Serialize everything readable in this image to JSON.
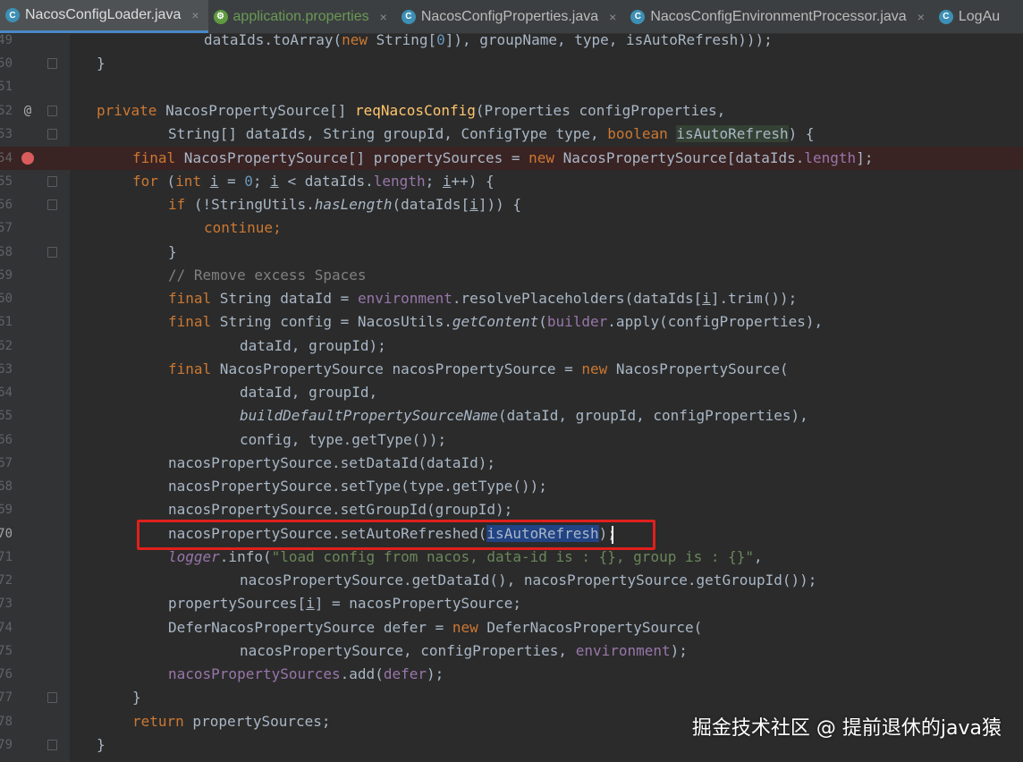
{
  "tabs": [
    {
      "label": "NacosConfigLoader.java",
      "icon": "java-class-icon",
      "active": true
    },
    {
      "label": "application.properties",
      "icon": "properties-file-icon",
      "active": false
    },
    {
      "label": "NacosConfigProperties.java",
      "icon": "java-class-icon",
      "active": false
    },
    {
      "label": "NacosConfigEnvironmentProcessor.java",
      "icon": "java-class-icon",
      "active": false
    },
    {
      "label": "LogAu",
      "icon": "java-class-icon",
      "active": false
    }
  ],
  "tab_close_glyph": "×",
  "gutter": {
    "line_numbers": [
      "49",
      "50",
      "51",
      "52",
      "53",
      "54",
      "55",
      "56",
      "57",
      "58",
      "59",
      "60",
      "61",
      "62",
      "63",
      "64",
      "65",
      "66",
      "67",
      "68",
      "69",
      "70",
      "71",
      "72",
      "73",
      "74",
      "75",
      "76",
      "77",
      "78",
      "79"
    ],
    "override_glyph": "@"
  },
  "code": {
    "l49_a": "dataIds.toArray(",
    "l49_b": "new",
    "l49_c": " String[",
    "l49_d": "0",
    "l49_e": "]), groupName, type, isAutoRefresh)));",
    "l50": "}",
    "l52_a": "private",
    "l52_b": " NacosPropertySource[] ",
    "l52_c": "reqNacosConfig",
    "l52_d": "(Properties configProperties,",
    "l53_a": "String[] dataIds, String groupId, ConfigType type, ",
    "l53_b": "boolean",
    "l53_c": " ",
    "l53_d": "isAutoRefresh",
    "l53_e": ") {",
    "l54_a": "final",
    "l54_b": " NacosPropertySource[] propertySources = ",
    "l54_c": "new",
    "l54_d": " NacosPropertySource[dataIds.",
    "l54_e": "length",
    "l54_f": "];",
    "l55_a": "for",
    "l55_b": " (",
    "l55_c": "int",
    "l55_d": " ",
    "l55_e": "i",
    "l55_f": " = ",
    "l55_g": "0",
    "l55_h": "; ",
    "l55_i": "i",
    "l55_j": " < dataIds.",
    "l55_k": "length",
    "l55_l": "; ",
    "l55_m": "i",
    "l55_n": "++) {",
    "l56_a": "if",
    "l56_b": " (!StringUtils.",
    "l56_c": "hasLength",
    "l56_d": "(dataIds[",
    "l56_e": "i",
    "l56_f": "])) {",
    "l57": "continue;",
    "l58": "}",
    "l59": "// Remove excess Spaces",
    "l60_a": "final",
    "l60_b": " String dataId = ",
    "l60_c": "environment",
    "l60_d": ".resolvePlaceholders(dataIds[",
    "l60_e": "i",
    "l60_f": "].trim());",
    "l61_a": "final",
    "l61_b": " String config = NacosUtils.",
    "l61_c": "getContent",
    "l61_d": "(",
    "l61_e": "builder",
    "l61_f": ".apply(configProperties),",
    "l62": "dataId, groupId);",
    "l63_a": "final",
    "l63_b": " NacosPropertySource nacosPropertySource = ",
    "l63_c": "new",
    "l63_d": " NacosPropertySource(",
    "l64": "dataId, groupId,",
    "l65_a": "buildDefaultPropertySourceName",
    "l65_b": "(dataId, groupId, configProperties),",
    "l66": "config, type.getType());",
    "l67": "nacosPropertySource.setDataId(dataId);",
    "l68": "nacosPropertySource.setType(type.getType());",
    "l69": "nacosPropertySource.setGroupId(groupId);",
    "l70_a": "nacosPropertySource.setAutoRefreshed(",
    "l70_b": "isAutoRefresh",
    "l70_c": ");",
    "l71_a": "logger",
    "l71_b": ".info(",
    "l71_c": "\"load config from nacos, data-id is : {}, group is : {}\"",
    "l71_d": ",",
    "l72": "nacosPropertySource.getDataId(), nacosPropertySource.getGroupId());",
    "l73_a": "propertySources[",
    "l73_b": "i",
    "l73_c": "] = nacosPropertySource;",
    "l74_a": "DeferNacosPropertySource defer = ",
    "l74_b": "new",
    "l74_c": " DeferNacosPropertySource(",
    "l75_a": "nacosPropertySource, configProperties, ",
    "l75_b": "environment",
    "l75_c": ");",
    "l76_a": "nacosPropertySources",
    "l76_b": ".add(",
    "l76_c": "defer",
    "l76_d": ");",
    "l77": "}",
    "l78_a": "return",
    "l78_b": " propertySources;",
    "l79": "}"
  },
  "watermark": "掘金技术社区 @ 提前退休的java猿",
  "colors": {
    "editor_bg": "#2b2b2b",
    "keyword": "#cc7832",
    "field": "#9876aa",
    "method_decl": "#ffc66d",
    "number": "#6897bb",
    "comment": "#808080",
    "string": "#6a8759",
    "highlight_box": "#e0201c",
    "selection": "#214283"
  }
}
